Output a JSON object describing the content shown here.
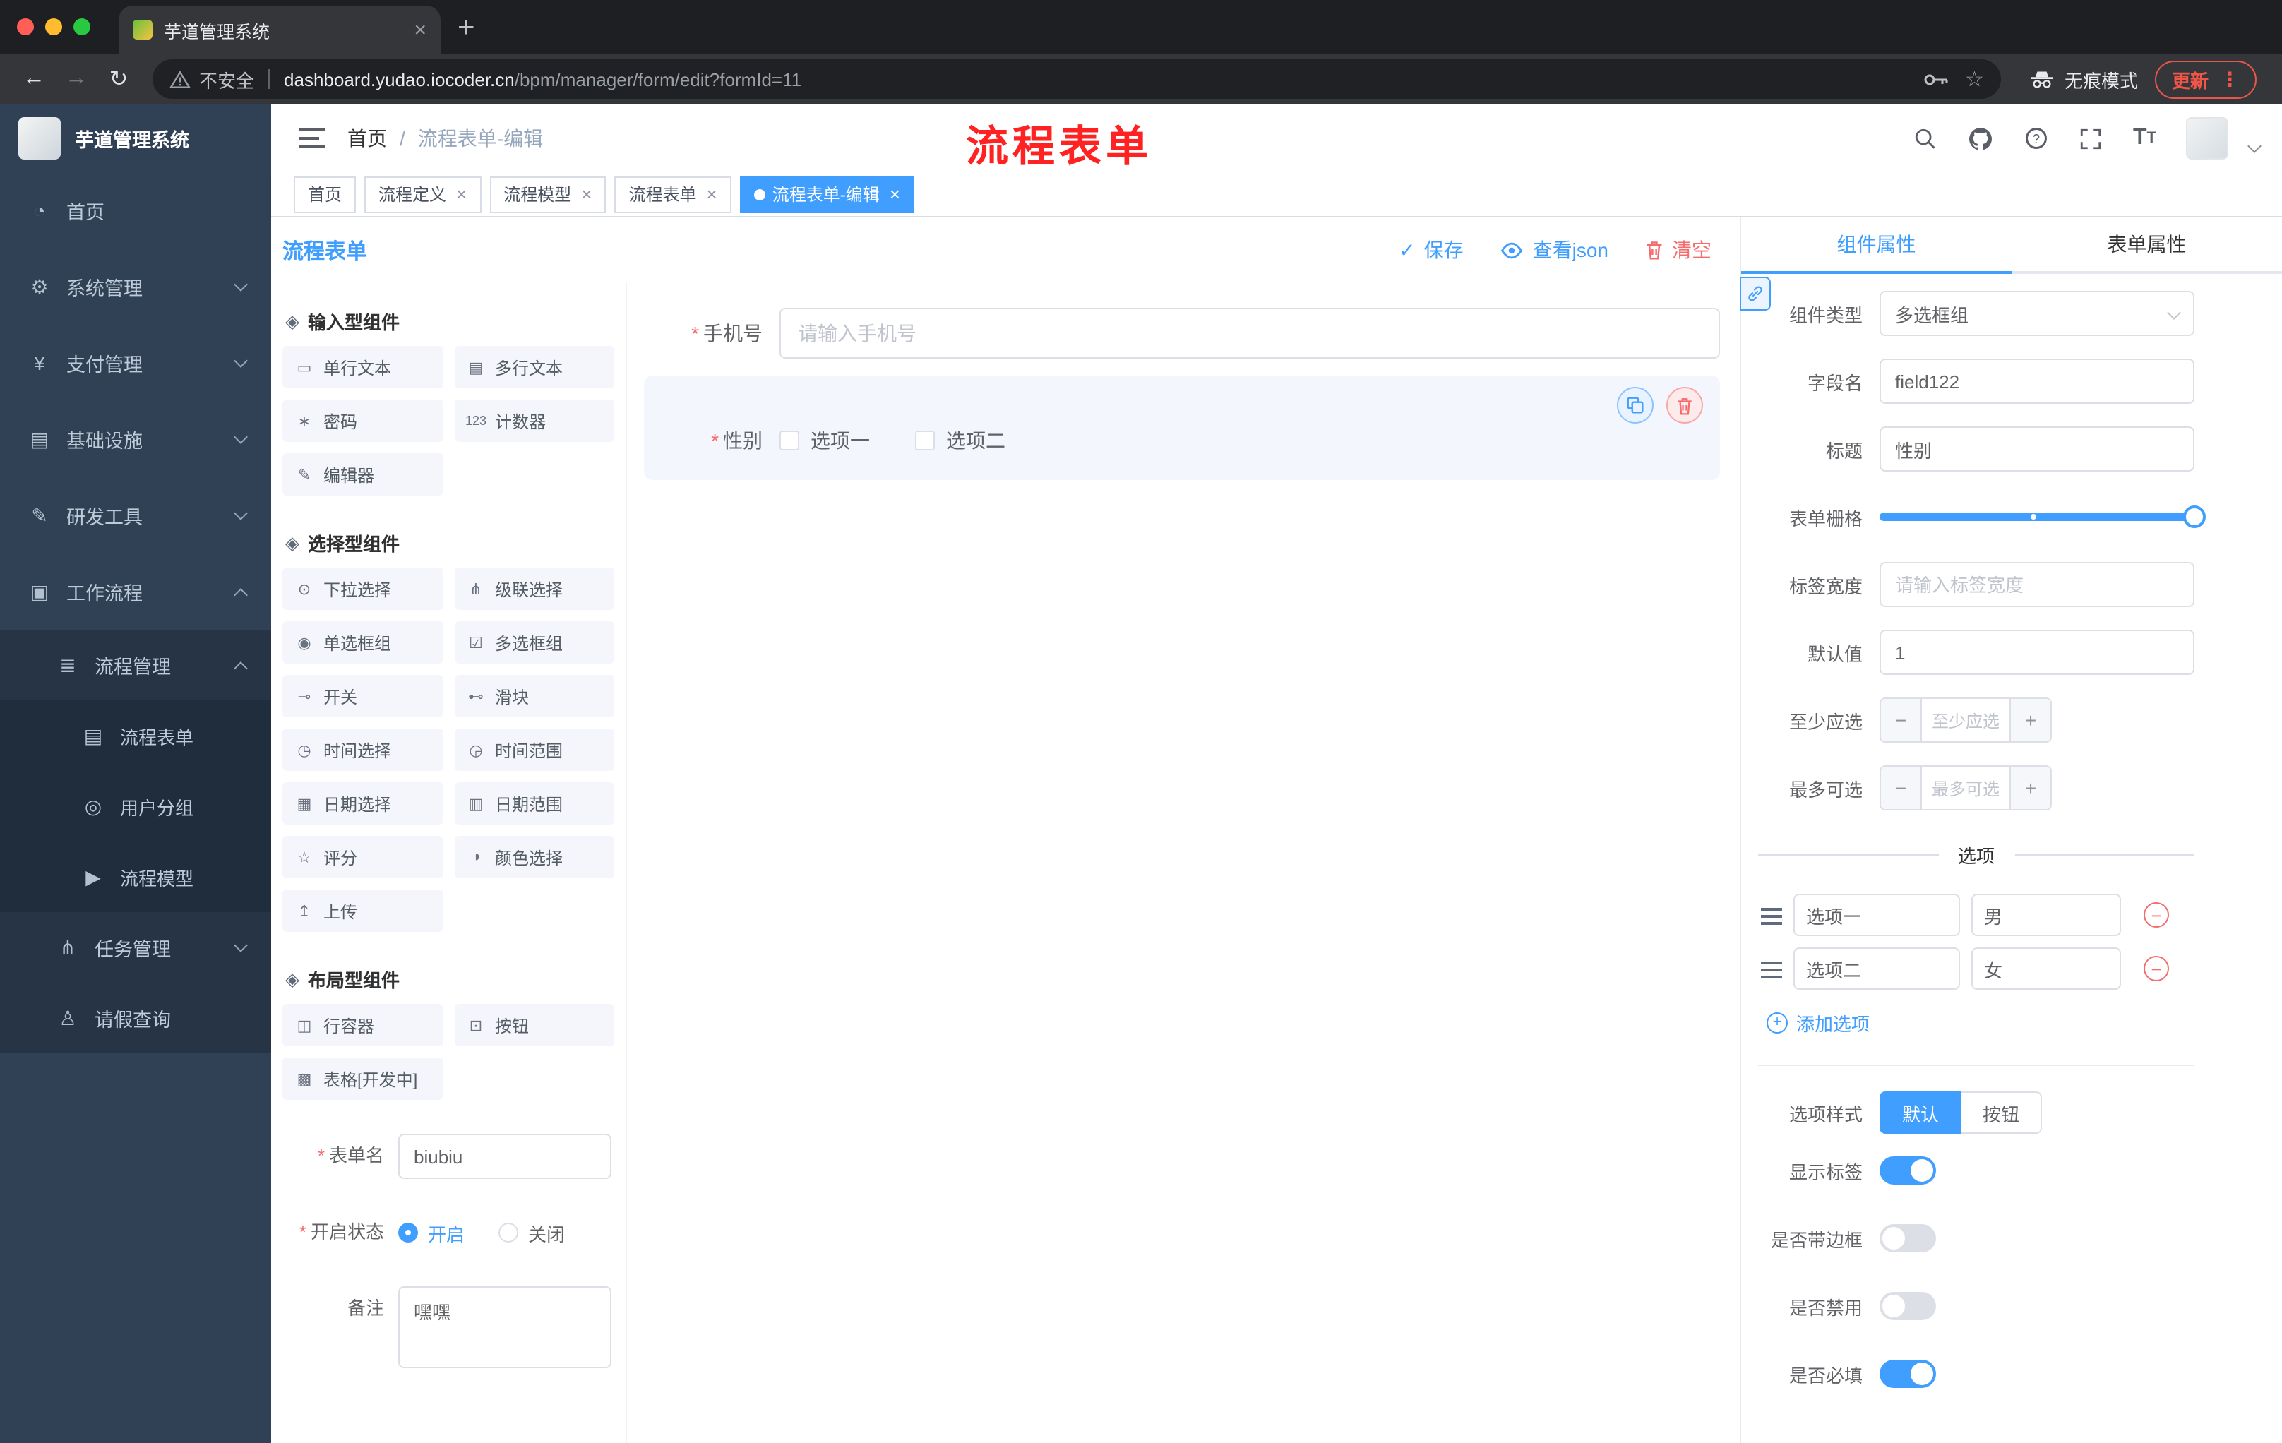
{
  "browser": {
    "tab_title": "芋道管理系统",
    "security_label": "不安全",
    "url_domain": "dashboard.yudao.iocoder.cn",
    "url_path": "/bpm/manager/form/edit?formId=11",
    "incognito_label": "无痕模式",
    "update_label": "更新"
  },
  "sidebar": {
    "logo_title": "芋道管理系统",
    "items": [
      {
        "label": "首页",
        "icon": "dashboard-icon",
        "glyph": "◔"
      },
      {
        "label": "系统管理",
        "icon": "gear-icon",
        "glyph": "⚙"
      },
      {
        "label": "支付管理",
        "icon": "yen-icon",
        "glyph": "¥"
      },
      {
        "label": "基础设施",
        "icon": "infrastructure-icon",
        "glyph": "▤"
      },
      {
        "label": "研发工具",
        "icon": "tools-icon",
        "glyph": "✎"
      },
      {
        "label": "工作流程",
        "icon": "briefcase-icon",
        "glyph": "▣"
      },
      {
        "label": "流程管理",
        "icon": "list-icon",
        "glyph": "≣"
      },
      {
        "label": "流程表单",
        "icon": "form-icon",
        "glyph": "▤"
      },
      {
        "label": "用户分组",
        "icon": "users-icon",
        "glyph": "◎"
      },
      {
        "label": "流程模型",
        "icon": "model-icon",
        "glyph": "▶"
      },
      {
        "label": "任务管理",
        "icon": "fork-icon",
        "glyph": "⋔"
      },
      {
        "label": "请假查询",
        "icon": "person-icon",
        "glyph": "♙"
      }
    ]
  },
  "header": {
    "breadcrumb_home": "首页",
    "breadcrumb_separator": "/",
    "breadcrumb_current": "流程表单-编辑",
    "annotation": "流程表单"
  },
  "tags": [
    {
      "label": "首页"
    },
    {
      "label": "流程定义"
    },
    {
      "label": "流程模型"
    },
    {
      "label": "流程表单"
    },
    {
      "label": "流程表单-编辑"
    }
  ],
  "editor": {
    "title": "流程表单",
    "save_label": "保存",
    "view_json_label": "查看json",
    "clear_label": "清空"
  },
  "components_panel": {
    "groups": [
      {
        "title": "输入型组件",
        "items": [
          {
            "label": "单行文本",
            "icon": "text-field-icon",
            "glyph": "▭"
          },
          {
            "label": "多行文本",
            "icon": "textarea-icon",
            "glyph": "▤"
          },
          {
            "label": "密码",
            "icon": "lock-icon",
            "glyph": "∗"
          },
          {
            "label": "计数器",
            "icon": "counter-icon",
            "glyph": "123"
          },
          {
            "label": "编辑器",
            "icon": "editor-icon",
            "glyph": "✎"
          }
        ]
      },
      {
        "title": "选择型组件",
        "items": [
          {
            "label": "下拉选择",
            "icon": "select-icon",
            "glyph": "⊙"
          },
          {
            "label": "级联选择",
            "icon": "cascader-icon",
            "glyph": "⋔"
          },
          {
            "label": "单选框组",
            "icon": "radio-group-icon",
            "glyph": "◉"
          },
          {
            "label": "多选框组",
            "icon": "checkbox-group-icon",
            "glyph": "☑"
          },
          {
            "label": "开关",
            "icon": "switch-icon",
            "glyph": "⊸"
          },
          {
            "label": "滑块",
            "icon": "slider-icon",
            "glyph": "⊷"
          },
          {
            "label": "时间选择",
            "icon": "time-picker-icon",
            "glyph": "◷"
          },
          {
            "label": "时间范围",
            "icon": "time-range-icon",
            "glyph": "◶"
          },
          {
            "label": "日期选择",
            "icon": "date-picker-icon",
            "glyph": "▦"
          },
          {
            "label": "日期范围",
            "icon": "date-range-icon",
            "glyph": "▥"
          },
          {
            "label": "评分",
            "icon": "rate-icon",
            "glyph": "☆"
          },
          {
            "label": "颜色选择",
            "icon": "color-picker-icon",
            "glyph": "◑"
          },
          {
            "label": "上传",
            "icon": "upload-icon",
            "glyph": "↥"
          }
        ]
      },
      {
        "title": "布局型组件",
        "items": [
          {
            "label": "行容器",
            "icon": "row-container-icon",
            "glyph": "◫"
          },
          {
            "label": "按钮",
            "icon": "button-icon",
            "glyph": "⊡"
          },
          {
            "label": "表格[开发中]",
            "icon": "table-icon",
            "glyph": "▩"
          }
        ]
      }
    ],
    "form": {
      "name_label": "表单名",
      "name_value": "biubiu",
      "status_label": "开启状态",
      "status_on": "开启",
      "status_off": "关闭",
      "remark_label": "备注",
      "remark_value": "嘿嘿"
    }
  },
  "canvas": {
    "phone_label": "手机号",
    "phone_placeholder": "请输入手机号",
    "gender_label": "性别",
    "gender_option1": "选项一",
    "gender_option2": "选项二"
  },
  "props": {
    "tab_component": "组件属性",
    "tab_form": "表单属性",
    "type_label": "组件类型",
    "type_value": "多选框组",
    "field_label": "字段名",
    "field_value": "field122",
    "title_label": "标题",
    "title_value": "性别",
    "grid_label": "表单栅格",
    "width_label": "标签宽度",
    "width_placeholder": "请输入标签宽度",
    "default_label": "默认值",
    "default_value": "1",
    "min_label": "至少应选",
    "min_placeholder": "至少应选",
    "max_label": "最多可选",
    "max_placeholder": "最多可选",
    "options_title": "选项",
    "options": [
      {
        "name": "选项一",
        "value": "男"
      },
      {
        "name": "选项二",
        "value": "女"
      }
    ],
    "add_option": "添加选项",
    "style_label": "选项样式",
    "style_default": "默认",
    "style_button": "按钮",
    "toggle_show_label": "显示标签",
    "toggle_border": "是否带边框",
    "toggle_disabled": "是否禁用",
    "toggle_required": "是否必填"
  },
  "colors": {
    "accent": "#409eff",
    "danger": "#f56c6c",
    "annotation_red": "#ff2222",
    "sidebar_bg": "#304156",
    "tag_active_bg": "#409eff"
  }
}
